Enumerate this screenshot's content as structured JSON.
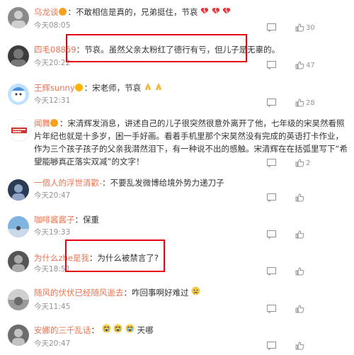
{
  "comments": [
    {
      "username": "乌龙谈",
      "separator": "：",
      "text": "不敢相信是真的，兄弟挺住，节哀",
      "emoji_names": [
        "broken-heart-icon",
        "broken-heart-icon",
        "broken-heart-icon"
      ],
      "time": "今天08:05",
      "likes": "30",
      "avatar_color": "#8a8a8a"
    },
    {
      "username": "四毛08859",
      "separator": "：",
      "text": "节哀。虽然父亲太粉红了德行有亏，但儿子是无辜的。",
      "time": "今天20:22",
      "likes": "47",
      "avatar_color": "#3c3c3c"
    },
    {
      "username": "王辉sunny",
      "separator": "：",
      "text": "宋老师，节哀",
      "emoji_names": [
        "pray-icon",
        "pray-icon"
      ],
      "time": "今天12:31",
      "likes": "28",
      "avatar_color": "#4a90d9"
    },
    {
      "username": "闻舞",
      "separator": "：",
      "text": "宋清辉发消息，讲述自己的儿子很突然很意外离开了他，七年级的宋昊然看照片年纪也就是十多岁，困一手好画。看着手机里那个宋昊然没有完成的英语打卡作业，作为三个孩子孩子的父亲我潸然泪下，有一种说不出的感触。宋清辉在在括弧里写下“希望能够真正落实双减”的文字！",
      "time": "今天20:52",
      "likes": "2",
      "avatar_color": "#d0312d"
    },
    {
      "username": "一個人的浮世清歡-",
      "separator": "：",
      "text": "不要乱发微博给境外势力递刀子",
      "time": "今天20:47",
      "likes": "",
      "avatar_color": "#2b3a55"
    },
    {
      "username": "咖啡酱酱子",
      "separator": "：",
      "text": "保重",
      "time": "今天19:33",
      "likes": "",
      "avatar_color": "#7fb3e0"
    },
    {
      "username": "为什么zhe是我",
      "separator": "：",
      "text": "为什么被禁言了?",
      "time": "今天18:51",
      "likes": "",
      "avatar_color": "#555555"
    },
    {
      "username": "随风的伏伏已经随风逝去",
      "separator": "：",
      "text": "咋回事啊好难过",
      "emoji_names": [
        "sad-face-icon"
      ],
      "time": "今天11:45",
      "likes": "",
      "avatar_color": "#9a9a9a"
    },
    {
      "username": "安娜的三千乱话",
      "separator": "：",
      "text": "天哪",
      "emoji_names": [
        "crying-face-icon",
        "crying-face-icon",
        "crying-face-icon"
      ],
      "time": "今天20:47",
      "likes": "",
      "avatar_color": "#6d6d6d"
    }
  ],
  "colors": {
    "username": "#eb7350",
    "highlight_border": "#e60012",
    "meta_text": "#939393"
  },
  "icons": {
    "reply": "reply-icon",
    "like": "thumbs-up-icon",
    "verified": "verified-badge-icon"
  }
}
